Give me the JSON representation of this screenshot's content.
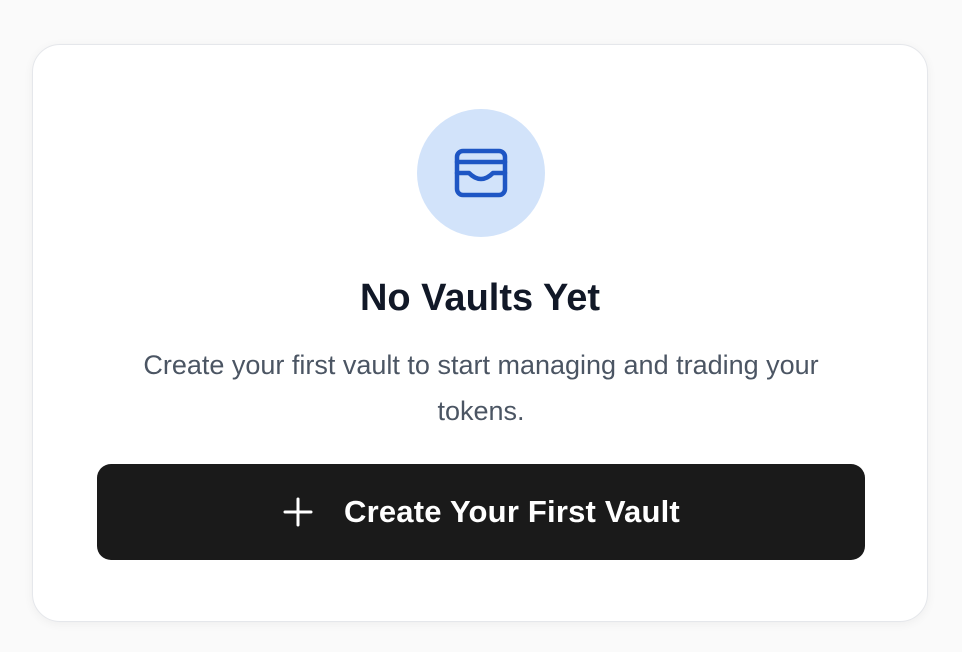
{
  "empty_state": {
    "icon": "wallet-icon",
    "title": "No Vaults Yet",
    "description": "Create your first vault to start managing and trading your tokens.",
    "cta_label": "Create Your First Vault",
    "cta_icon": "plus-icon"
  },
  "colors": {
    "icon_background": "#d2e3fa",
    "icon_stroke": "#1e56c4",
    "button_background": "#1a1a1a",
    "button_text": "#ffffff",
    "title_text": "#111827",
    "description_text": "#4b5563"
  }
}
